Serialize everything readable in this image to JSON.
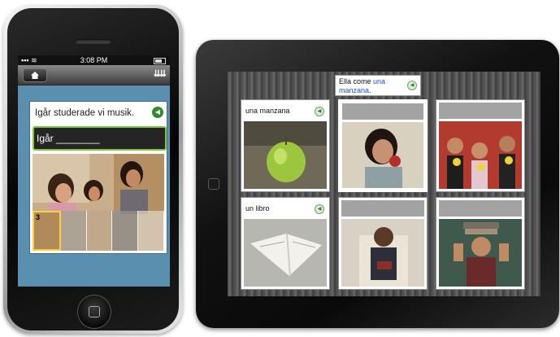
{
  "iphone": {
    "status": {
      "signal": "▪▪▪ ≋",
      "time": "3:08 PM"
    },
    "nav": {
      "home_icon": "home-icon",
      "arrows_icon": "⇊⇊"
    },
    "prompt": "Igår studerade vi musik.",
    "answer": "Igår ________",
    "thumb_numbers": [
      "3",
      "",
      "",
      "",
      ""
    ]
  },
  "ipad": {
    "caption": {
      "prefix": "Ella come ",
      "highlight": "una manzana",
      "suffix": "."
    },
    "cells": [
      {
        "label": "una manzana",
        "blank": false
      },
      {
        "label": "",
        "blank": true
      },
      {
        "label": "",
        "blank": true
      },
      {
        "label": "un libro",
        "blank": false
      },
      {
        "label": "",
        "blank": true
      },
      {
        "label": "",
        "blank": true
      }
    ]
  },
  "colors": {
    "accent_green": "#7ec63a",
    "highlight_blue": "#1b4fd8",
    "screen_blue": "#5b8fb0"
  }
}
